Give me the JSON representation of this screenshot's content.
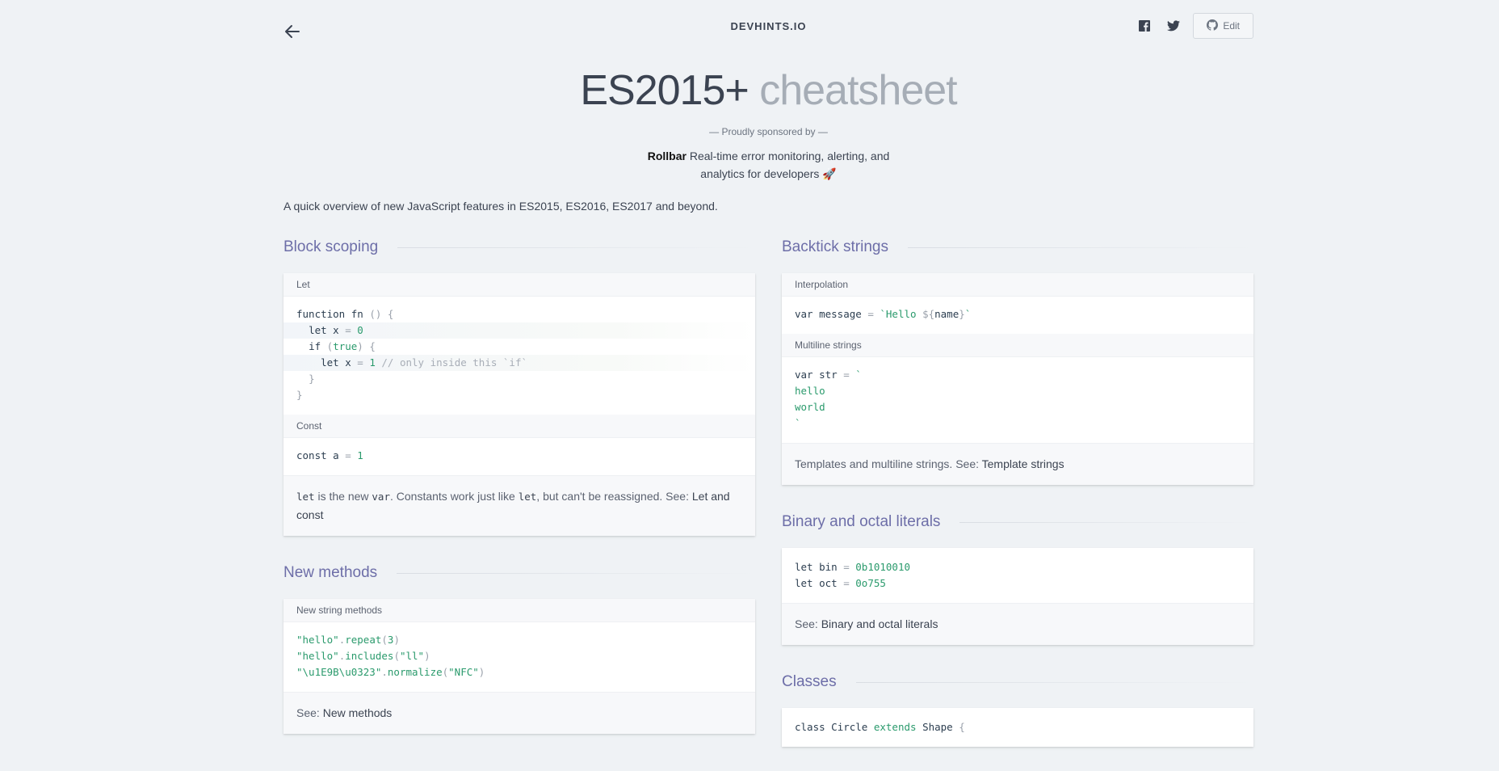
{
  "header": {
    "brand": "DEVHINTS.IO",
    "edit_label": "Edit",
    "back_icon": "arrow-left-icon",
    "facebook_icon": "facebook-icon",
    "twitter_icon": "twitter-icon",
    "github_icon": "github-icon"
  },
  "title": {
    "main": "ES2015+",
    "suffix": "cheatsheet"
  },
  "sponsor": {
    "label": "— Proudly sponsored by —",
    "name": "Rollbar",
    "text": "Real-time error monitoring, alerting, and",
    "text2": "analytics for developers 🚀"
  },
  "intro": "A quick overview of new JavaScript features in ES2015, ES2016, ES2017 and beyond.",
  "block_scoping": {
    "title": "Block scoping",
    "let_label": "Let",
    "let_code": [
      "function fn () {",
      "  let x = 0",
      "  if (true) {",
      "    let x = 1 // only inside this `if`",
      "  }",
      "}"
    ],
    "const_label": "Const",
    "const_code": "const a = 1",
    "note_let": "let",
    "note_text1": " is the new ",
    "note_var": "var",
    "note_text2": ". Constants work just like ",
    "note_let2": "let",
    "note_text3": ", but can't be reassigned. See: ",
    "note_link": "Let and const"
  },
  "new_methods": {
    "title": "New methods",
    "label": "New string methods",
    "code": [
      "\"hello\".repeat(3)",
      "\"hello\".includes(\"ll\")",
      "\"\\u1E9B\\u0323\".normalize(\"NFC\")"
    ],
    "note_prefix": "See: ",
    "note_link": "New methods"
  },
  "backtick": {
    "title": "Backtick strings",
    "interp_label": "Interpolation",
    "interp_code": "var message = `Hello ${name}`",
    "multi_label": "Multiline strings",
    "multi_code": [
      "var str = `",
      "hello",
      "world",
      "`"
    ],
    "note_prefix": "Templates and multiline strings. See: ",
    "note_link": "Template strings"
  },
  "binary": {
    "title": "Binary and octal literals",
    "code": [
      "let bin = 0b1010010",
      "let oct = 0o755"
    ],
    "note_prefix": "See: ",
    "note_link": "Binary and octal literals"
  },
  "classes": {
    "title": "Classes",
    "code": "class Circle extends Shape {"
  }
}
